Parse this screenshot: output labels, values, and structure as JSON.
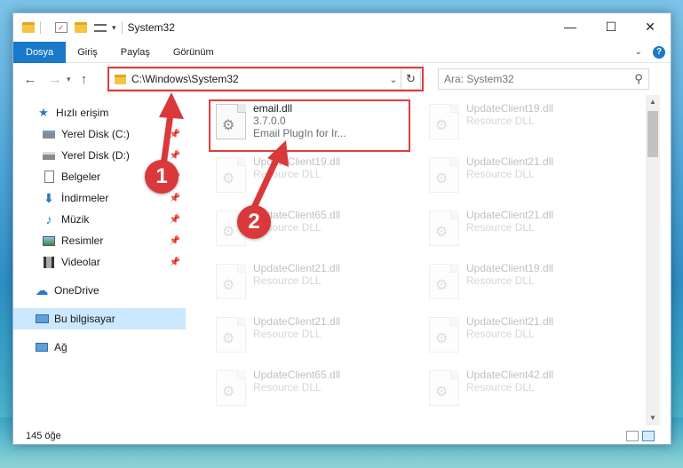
{
  "window": {
    "title": "System32"
  },
  "ribbon": {
    "tabs": [
      {
        "label": "Dosya",
        "active": true
      },
      {
        "label": "Giriş",
        "active": false
      },
      {
        "label": "Paylaş",
        "active": false
      },
      {
        "label": "Görünüm",
        "active": false
      }
    ],
    "help": "?"
  },
  "nav": {
    "back": "←",
    "forward": "→",
    "up": "↑",
    "address": "C:\\Windows\\System32",
    "search_placeholder": "Ara: System32"
  },
  "sidebar": {
    "items": [
      {
        "label": "Hızlı erişim",
        "icon": "star-icon"
      },
      {
        "label": "Yerel Disk (C:)",
        "icon": "drive-icon",
        "pinned": true
      },
      {
        "label": "Yerel Disk (D:)",
        "icon": "drive-icon",
        "pinned": true
      },
      {
        "label": "Belgeler",
        "icon": "documents-icon",
        "pinned": true
      },
      {
        "label": "İndirmeler",
        "icon": "download-icon",
        "pinned": true
      },
      {
        "label": "Müzik",
        "icon": "music-icon",
        "pinned": true
      },
      {
        "label": "Resimler",
        "icon": "pictures-icon",
        "pinned": true
      },
      {
        "label": "Videolar",
        "icon": "videos-icon",
        "pinned": true
      },
      {
        "label": "OneDrive",
        "icon": "cloud-icon"
      },
      {
        "label": "Bu bilgisayar",
        "icon": "computer-icon",
        "selected": true
      },
      {
        "label": "Ağ",
        "icon": "network-icon"
      }
    ]
  },
  "files": [
    {
      "name": "email.dll",
      "line2": "3.7.0.0",
      "line3": "Email PlugIn for Ir...",
      "highlighted": true
    },
    {
      "name": "UpdateClient19.dll",
      "line2": "Resource DLL"
    },
    {
      "name": "UpdateClient19.dll",
      "line2": "Resource DLL"
    },
    {
      "name": "UpdateClient21.dll",
      "line2": "Resource DLL"
    },
    {
      "name": "UpdateClient65.dll",
      "line2": "Resource DLL"
    },
    {
      "name": "UpdateClient21.dll",
      "line2": "Resource DLL"
    },
    {
      "name": "UpdateClient21.dll",
      "line2": "Resource DLL"
    },
    {
      "name": "UpdateClient19.dll",
      "line2": "Resource DLL"
    },
    {
      "name": "UpdateClient21.dll",
      "line2": "Resource DLL"
    },
    {
      "name": "UpdateClient21.dll",
      "line2": "Resource DLL"
    },
    {
      "name": "UpdateClient65.dll",
      "line2": "Resource DLL"
    },
    {
      "name": "UpdateClient42.dll",
      "line2": "Resource DLL"
    }
  ],
  "status": {
    "count": "145 öğe"
  },
  "callouts": {
    "one": "1",
    "two": "2"
  },
  "colors": {
    "accent": "#1979ca",
    "highlight": "#e23c3c",
    "selected": "#cce8ff"
  }
}
